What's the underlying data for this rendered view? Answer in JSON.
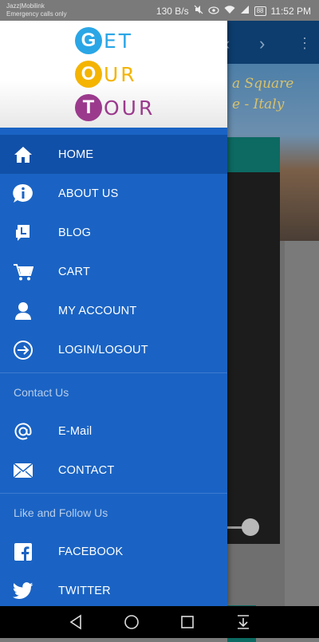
{
  "status_bar": {
    "carrier": "Jazz|Mobilink",
    "emergency": "Emergency calls only",
    "speed": "130 B/s",
    "battery": "88",
    "time": "11:52 PM"
  },
  "background_app": {
    "hero_text_line1": "a Square",
    "hero_text_line2": "e - Italy"
  },
  "logo": {
    "rows": [
      {
        "letter": "G",
        "rest": "ET",
        "color": "#2aa6e6"
      },
      {
        "letter": "O",
        "rest": "UR",
        "color": "#f4b400"
      },
      {
        "letter": "T",
        "rest": "OUR",
        "color": "#9b3a8d"
      }
    ]
  },
  "menu": {
    "items": [
      {
        "label": "HOME",
        "icon": "home-icon"
      },
      {
        "label": "ABOUT US",
        "icon": "info-icon"
      },
      {
        "label": "BLOG",
        "icon": "blog-icon"
      },
      {
        "label": "CART",
        "icon": "cart-icon"
      },
      {
        "label": "MY ACCOUNT",
        "icon": "person-icon"
      },
      {
        "label": "LOGIN/LOGOUT",
        "icon": "login-icon"
      }
    ],
    "contact_section": "Contact Us",
    "contact_items": [
      {
        "label": "E-Mail",
        "icon": "at-icon"
      },
      {
        "label": "CONTACT",
        "icon": "envelope-icon"
      }
    ],
    "follow_section": "Like and Follow Us",
    "follow_items": [
      {
        "label": "FACEBOOK",
        "icon": "facebook-icon"
      },
      {
        "label": "TWITTER",
        "icon": "twitter-icon"
      }
    ]
  },
  "colors": {
    "drawer": "#1a63c4",
    "drawer_active": "#1150a8",
    "nav_bar": "#000000"
  }
}
